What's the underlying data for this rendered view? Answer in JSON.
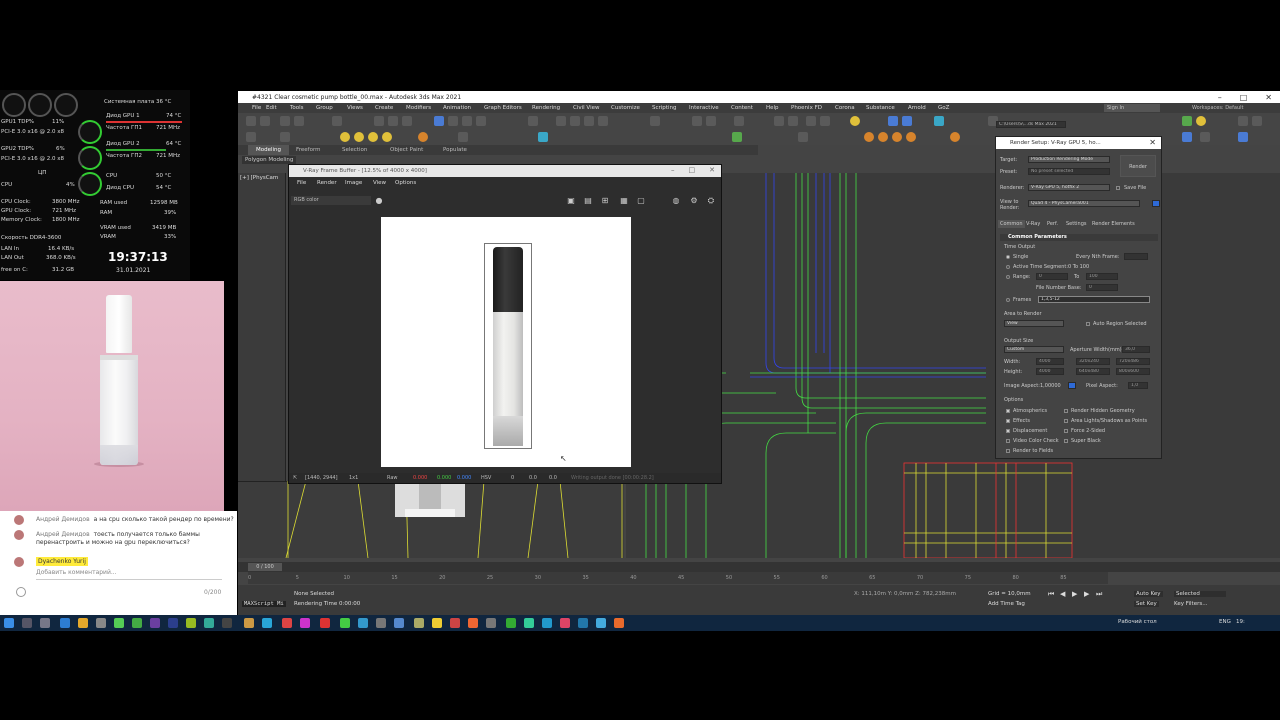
{
  "monitor": {
    "tdp": [
      "GPU1 TDP%",
      "GPU2 TDP%"
    ],
    "tdp_vals": [
      "11%",
      "6%"
    ],
    "pcie": [
      "PCI-E 3.0 x16 @ 2.0 x8",
      "PCI-E 3.0 x16 @ 2.0 x8"
    ],
    "cpu_label": "CPU",
    "cpu_val": "4%",
    "cpu_small": "ЦП",
    "system_board": "Системная плата 36 °C",
    "gpu1_diode": "Диод GPU 1",
    "gpu1_diode_val": "74 °C",
    "gpu1_freq": "Частота ГП1",
    "gpu1_freq_val": "721 MHz",
    "gpu2_diode": "Диод GPU 2",
    "gpu2_diode_val": "64 °C",
    "gpu2_freq": "Частота ГП2",
    "gpu2_freq_val": "721 MHz",
    "cpu2": "CPU",
    "cpu2_val": "50 °C",
    "cpu_diode": "Диод CPU",
    "cpu_diode_val": "54 °C",
    "cpu_clock": "CPU Clock:",
    "cpu_clock_val": "3800 MHz",
    "gpu_clock": "GPU Clock:",
    "gpu_clock_val": "721 MHz",
    "mem_clock": "Memory Clock:",
    "mem_clock_val": "1800 MHz",
    "speed": "Скорость DDR4-3600",
    "ram_used": "RAM used",
    "ram_used_val": "12598 MB",
    "ram": "RAM",
    "ram_val": "39%",
    "vram_used": "VRAM used",
    "vram_used_val": "3419 MB",
    "vram": "VRAM",
    "vram_val": "33%",
    "lan_in": "LAN In",
    "lan_in_val": "16.4 KB/s",
    "lan_out": "LAN Out",
    "lan_out_val": "368.0 KB/s",
    "free_c": "free on C:",
    "free_c_val": "31.2 GB",
    "clock": "19:37:13",
    "date": "31.01.2021"
  },
  "chat": {
    "messages": [
      {
        "author": "Андрей Демидов",
        "text": "а на cpu сколько такой рендер по времени?"
      },
      {
        "author": "Андрей Демидов",
        "text": "тоесть получается только баммы"
      },
      {
        "author": "",
        "text": "перенастроить и можно на gpu переключиться?"
      }
    ],
    "highlight": "Dyachenko Yurij",
    "input_placeholder": "Добавить комментарий...",
    "counter": "0/200"
  },
  "max": {
    "title": "#4321 Clear cosmetic pump bottle_00.max - Autodesk 3ds Max 2021",
    "menu": [
      "File",
      "Edit",
      "Tools",
      "Group",
      "Views",
      "Create",
      "Modifiers",
      "Animation",
      "Graph Editors",
      "Rendering",
      "Civil View",
      "Customize",
      "Scripting",
      "Interactive",
      "Content",
      "Help",
      "Phoenix FD",
      "Corona",
      "Substance",
      "Arnold",
      "GoZ"
    ],
    "signin": "Sign In",
    "workspaces": "Workspaces: Default",
    "ribbon": [
      "Modeling",
      "Freeform",
      "Selection",
      "Object Paint",
      "Populate"
    ],
    "polymod": "Polygon Modeling",
    "viewport_label": "[+] [PhysCam",
    "timeline": "0 / 100",
    "ruler": [
      "0",
      "5",
      "10",
      "15",
      "20",
      "25",
      "30",
      "35",
      "40",
      "45",
      "50",
      "55",
      "60",
      "65",
      "70",
      "75",
      "80",
      "85"
    ],
    "maxscript": "MAXScript Mi",
    "selected": "None Selected",
    "render_time": "Rendering Time 0:00:00",
    "coords": "X: 111,10m  Y: 0,0mm  Z: 782,238mm",
    "grid": "Grid = 10,0mm",
    "add_time_tag": "Add Time Tag",
    "auto_key": "Auto Key",
    "set_key": "Set Key",
    "sel_mode": "Selected",
    "key_filters": "Key Filters..."
  },
  "vfb": {
    "title": "V-Ray Frame Buffer - [12.5% of 4000 x 4000]",
    "menu": [
      "File",
      "Render",
      "Image",
      "View",
      "Options"
    ],
    "channel": "RGB color",
    "coords": "[1440, 2944]",
    "ratio": "1x1",
    "mode": "Raw",
    "r": "0.000",
    "g": "0.000",
    "b": "0.000",
    "hsv": "HSV",
    "v1": "0",
    "v2": "0.0",
    "v3": "0.0",
    "status": "Writing output done [00:00:28.2]"
  },
  "rs": {
    "title": "Render Setup: V-Ray GPU 5, ho...",
    "target_label": "Target:",
    "target": "Production Rendering Mode",
    "preset_label": "Preset:",
    "preset": "No preset selected",
    "renderer_label": "Renderer:",
    "renderer": "V-Ray GPU 5, hotfix 2",
    "save_file": "Save File",
    "view_label": "View to Render:",
    "view": "Quad 4 - PhysCamera001",
    "render_btn": "Render",
    "tabs": [
      "Common",
      "V-Ray",
      "Perf.",
      "Settings",
      "Render Elements"
    ],
    "common_params": "Common Parameters",
    "time_output": "Time Output",
    "single": "Single",
    "every_nth": "Every Nth Frame:",
    "active_seg": "Active Time Segment:",
    "active_seg_val": "0 To 100",
    "range": "Range:",
    "range_from": "0",
    "range_to_label": "To",
    "range_to": "100",
    "file_number_base": "File Number Base:",
    "fnb_val": "0",
    "frames": "Frames",
    "frames_val": "1,3,5-12",
    "area_label": "Area to Render",
    "area": "View",
    "auto_region": "Auto Region Selected",
    "output_size": "Output Size",
    "custom": "Custom",
    "aperture": "Aperture Width(mm):",
    "aperture_val": "36,0",
    "width": "Width:",
    "width_val": "4000",
    "height": "Height:",
    "height_val": "4000",
    "size_presets": [
      "320x240",
      "720x486",
      "640x480",
      "800x600"
    ],
    "image_aspect": "Image Aspect:",
    "image_aspect_val": "1,00000",
    "pixel_aspect": "Pixel Aspect:",
    "pixel_aspect_val": "1,0",
    "options": "Options",
    "opts_left": [
      "Atmospherics",
      "Effects",
      "Displacement",
      "Video Color Check",
      "Render to Fields"
    ],
    "opts_right": [
      "Render Hidden Geometry",
      "Area Lights/Shadows as Points",
      "Force 2-Sided",
      "Super Black"
    ],
    "path": "C:\\Users\\S\\...ds Max 2021"
  },
  "taskbar": {
    "desktop": "Рабочий стол",
    "lang": "ENG",
    "time": "19:"
  }
}
